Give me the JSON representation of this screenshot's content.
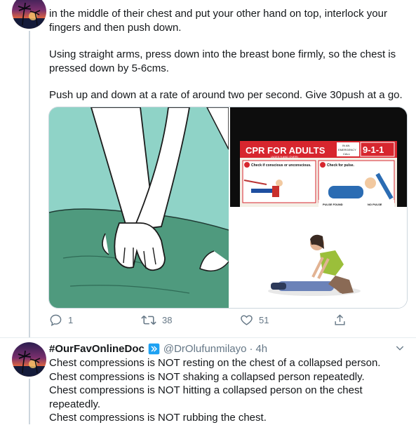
{
  "first_tweet": {
    "text_lines": [
      "in the middle of their chest and put your other hand on top, interlock your",
      "fingers and then push down."
    ],
    "paragraph2_lines": [
      "Using straight arms, press down into the breast bone firmly, so the chest is",
      "pressed down by 5-6cms."
    ],
    "paragraph3": "Push up and down at a rate of around two per second. Give 30push at a go.",
    "media": {
      "poster": {
        "title": "CPR FOR ADULTS",
        "subtitle": "(AGES 9 AND OVER)",
        "emergency_label_top": "IN AN",
        "emergency_label_mid": "EMERGENCY",
        "emergency_label_bot": "CALL",
        "emergency_number": "9-1-1",
        "step1_title": "Check if conscious or unconscious.",
        "step4_title": "Check for pulse.",
        "footer_left": "PULSE FOUND",
        "footer_right": "NO PULSE"
      }
    },
    "actions": {
      "reply_count": "1",
      "retweet_count": "38",
      "like_count": "51"
    }
  },
  "second_tweet": {
    "display_name": "#OurFavOnlineDoc",
    "handle": "@DrOlufunmilayo",
    "separator": "·",
    "time": "4h",
    "lines": [
      "Chest compressions is NOT resting on the chest of a collapsed person.",
      "Chest compressions is NOT shaking a collapsed person repeatedly.",
      "Chest compressions is NOT hitting a collapsed person on the chest",
      "repeatedly.",
      "Chest compressions is NOT rubbing the chest."
    ]
  },
  "colors": {
    "accent": "#1da1f2",
    "muted": "#657786",
    "border": "#ccd6dd",
    "poster_red": "#d7262e",
    "teal": "#8fd3c7",
    "green": "#4f9a7e"
  }
}
